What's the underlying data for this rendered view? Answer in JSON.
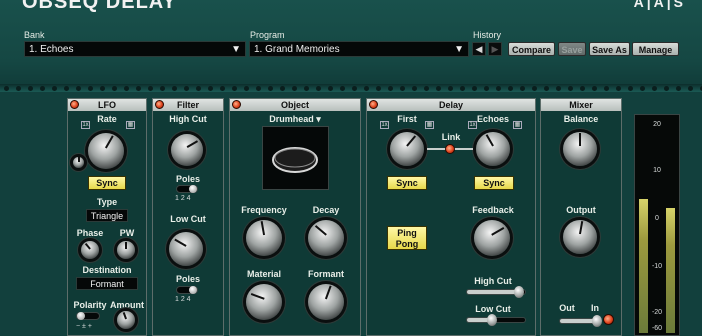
{
  "app": {
    "title": "OBSEQ DELAY",
    "logo": "A|A|S"
  },
  "bank": {
    "label": "Bank",
    "value": "1. Echoes"
  },
  "program": {
    "label": "Program",
    "value": "1. Grand Memories"
  },
  "history": {
    "label": "History"
  },
  "toolbar": {
    "compare": "Compare",
    "save": "Save",
    "save_as": "Save As",
    "manage": "Manage"
  },
  "lfo": {
    "title": "LFO",
    "rate": "Rate",
    "sync": "Sync",
    "type_label": "Type",
    "type_value": "Triangle",
    "phase": "Phase",
    "pw": "PW",
    "destination_label": "Destination",
    "destination_value": "Formant",
    "polarity": "Polarity",
    "polarity_marks": "−  ±  +",
    "amount": "Amount"
  },
  "filter": {
    "title": "Filter",
    "high_cut": "High Cut",
    "poles1": "Poles",
    "poles1_values": "1  2  4",
    "low_cut": "Low Cut",
    "poles2": "Poles",
    "poles2_values": "1  2  4"
  },
  "object": {
    "title": "Object",
    "model": "Drumhead",
    "frequency": "Frequency",
    "decay": "Decay",
    "material": "Material",
    "formant": "Formant"
  },
  "delay": {
    "title": "Delay",
    "first": "First",
    "link": "Link",
    "echoes": "Echoes",
    "sync1": "Sync",
    "sync2": "Sync",
    "ping_pong_1": "Ping",
    "ping_pong_2": "Pong",
    "feedback": "Feedback",
    "high_cut": "High Cut",
    "low_cut": "Low Cut"
  },
  "mixer": {
    "title": "Mixer",
    "balance": "Balance",
    "output": "Output",
    "out": "Out",
    "in": "In"
  },
  "meter": {
    "scale": [
      "20",
      "10",
      "0",
      "-10",
      "-20",
      "-60"
    ],
    "level_left": 0.62,
    "level_right": 0.58
  },
  "colors": {
    "background": "#12403d",
    "accent_yellow": "#f0e46a",
    "power_red": "#e0441e"
  }
}
